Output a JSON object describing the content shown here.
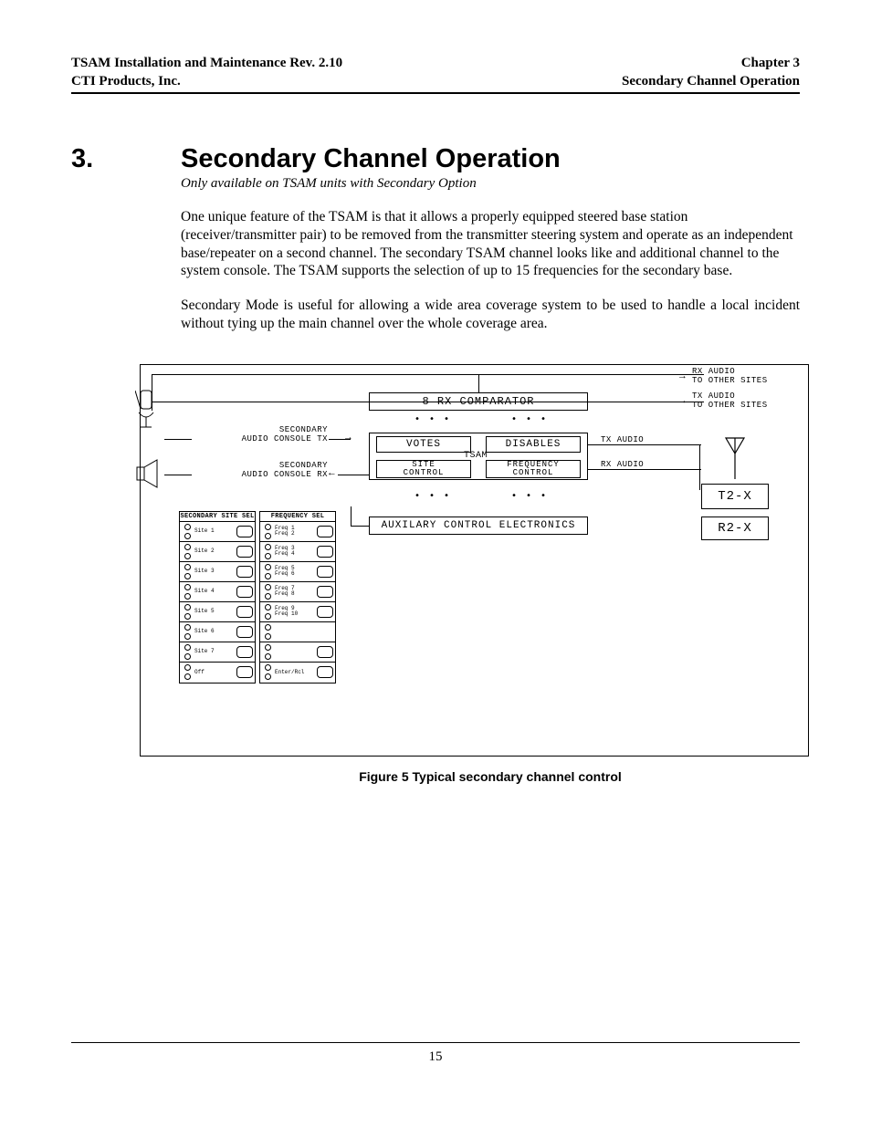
{
  "header": {
    "left_top": "TSAM Installation and Maintenance Rev. 2.10",
    "left_bottom": "CTI Products, Inc.",
    "right_top": "Chapter 3",
    "right_bottom": "Secondary Channel Operation"
  },
  "chapter": {
    "number": "3.",
    "title": "Secondary Channel Operation",
    "subtitle": "Only available on TSAM units with Secondary Option"
  },
  "paragraphs": {
    "p1": "One unique feature of the TSAM is that it allows a properly equipped steered base station (receiver/transmitter pair) to be removed from the transmitter steering system and operate as an independent base/repeater on a second channel.  The secondary TSAM channel looks like and additional channel to the system console.  The TSAM supports the selection of up to 15 frequencies for the secondary base.",
    "p2": "Secondary Mode is useful for allowing a wide area coverage system to be used to handle a local incident without tying up the main channel over the whole coverage area."
  },
  "figure": {
    "caption": "Figure 5   Typical secondary channel control",
    "labels": {
      "rx_comparator": "8 RX COMPARATOR",
      "votes": "VOTES",
      "disables": "DISABLES",
      "tsam": "TSAM",
      "site_control": "SITE\nCONTROL",
      "freq_control": "FREQUENCY\nCONTROL",
      "aux": "AUXILARY CONTROL ELECTRONICS",
      "t2x": "T2-X",
      "r2x": "R2-X",
      "sec_tx": "SECONDARY\nAUDIO CONSOLE TX",
      "sec_rx": "SECONDARY\nAUDIO CONSOLE RX",
      "rx_audio_sites": "RX AUDIO\nTO OTHER SITES",
      "tx_audio_sites": "TX AUDIO\nTO OTHER SITES",
      "tx_audio": "TX AUDIO",
      "rx_audio": "RX AUDIO",
      "site_sel": "SECONDARY SITE SEL",
      "freq_sel": "FREQUENCY SEL"
    },
    "site_panel_rows": [
      {
        "l": "Site 1",
        "btn": true
      },
      {
        "l": "Site 2",
        "btn": true
      },
      {
        "l": "Site 3",
        "btn": true
      },
      {
        "l": "Site 4",
        "btn": true
      },
      {
        "l": "Site 5",
        "btn": true
      },
      {
        "l": "Site 6",
        "btn": true
      },
      {
        "l": "Site 7",
        "btn": true
      },
      {
        "l": "Off",
        "btn": true
      }
    ],
    "freq_panel_rows": [
      {
        "l": "Freq 1\nFreq 2",
        "btn": true
      },
      {
        "l": "Freq 3\nFreq 4",
        "btn": true
      },
      {
        "l": "Freq 5\nFreq 6",
        "btn": true
      },
      {
        "l": "Freq 7\nFreq 8",
        "btn": true
      },
      {
        "l": "Freq 9\nFreq 10",
        "btn": true
      },
      {
        "l": "",
        "btn": false
      },
      {
        "l": "",
        "btn": true
      },
      {
        "l": "Enter/Rcl",
        "btn": true
      }
    ]
  },
  "page_number": "15"
}
